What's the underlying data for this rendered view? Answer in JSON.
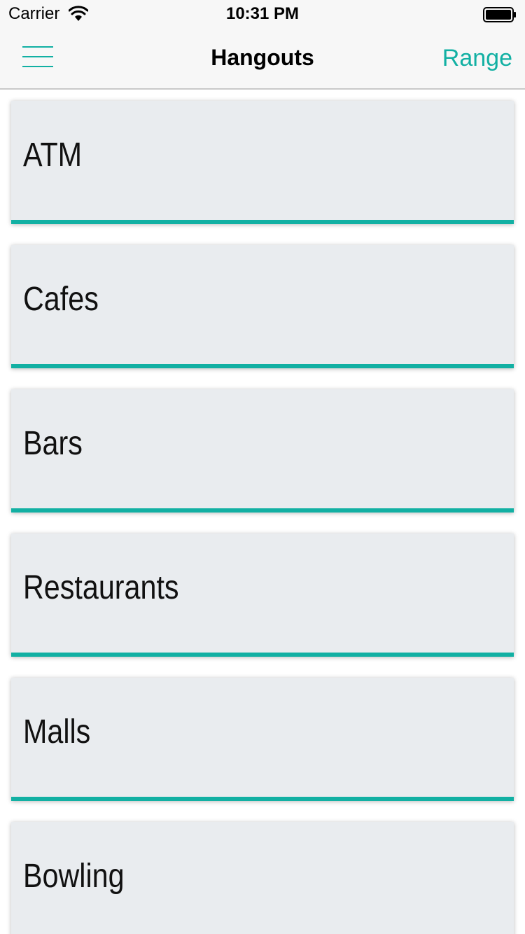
{
  "status_bar": {
    "carrier": "Carrier",
    "time": "10:31 PM",
    "wifi_icon": "wifi-icon",
    "battery_icon": "battery-full-icon"
  },
  "nav": {
    "menu_icon": "hamburger-menu-icon",
    "title": "Hangouts",
    "right_button": "Range"
  },
  "categories": [
    {
      "label": "ATM"
    },
    {
      "label": "Cafes"
    },
    {
      "label": "Bars"
    },
    {
      "label": "Restaurants"
    },
    {
      "label": "Malls"
    },
    {
      "label": "Bowling"
    }
  ],
  "colors": {
    "accent": "#12b0a3",
    "card_background": "#e9ecef",
    "nav_background": "#f7f7f7"
  }
}
